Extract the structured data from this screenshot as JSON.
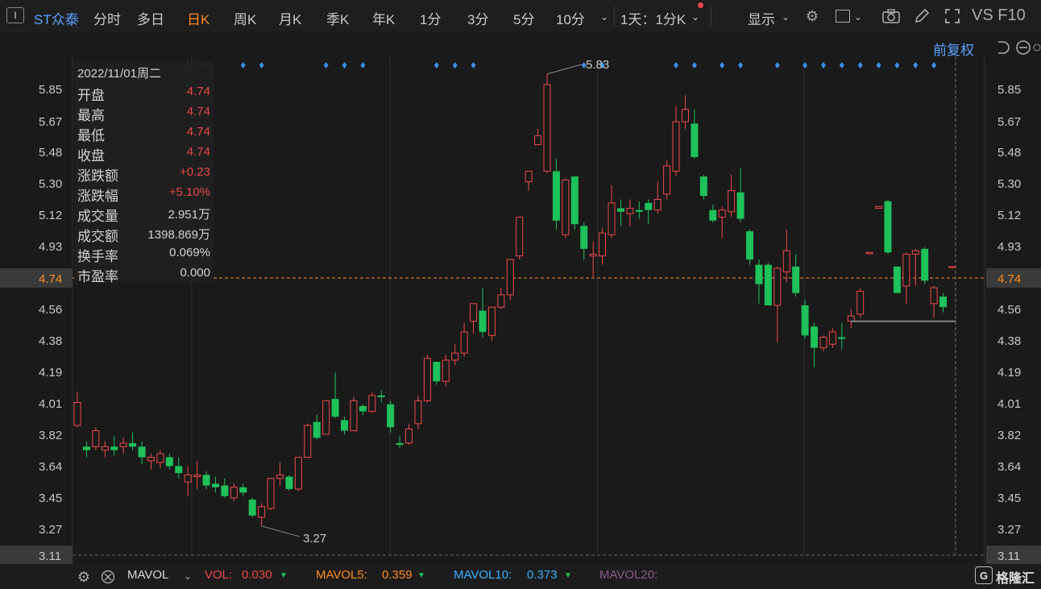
{
  "toolbar": {
    "symbol": "ST众泰",
    "tabs": [
      "分时",
      "多日",
      "日K",
      "周K",
      "月K",
      "季K",
      "年K",
      "1分",
      "3分",
      "5分",
      "10分"
    ],
    "active_tab": "日K",
    "period_select": "1天：1分K",
    "display": "显示",
    "right_text": "VS F10"
  },
  "adjust": "前复权",
  "colors": {
    "up": "#f04848",
    "down": "#1fc15a",
    "accent": "#ff8a1f",
    "blue": "#5aa0ff",
    "bg": "#1a1a1a"
  },
  "infobox": {
    "date": "2022/11/01周二",
    "rows": [
      {
        "label": "开盘",
        "value": "4.74",
        "color": "red"
      },
      {
        "label": "最高",
        "value": "4.74",
        "color": "red"
      },
      {
        "label": "最低",
        "value": "4.74",
        "color": "red"
      },
      {
        "label": "收盘",
        "value": "4.74",
        "color": "red"
      },
      {
        "label": "涨跌额",
        "value": "+0.23",
        "color": "red"
      },
      {
        "label": "涨跌幅",
        "value": "+5.10%",
        "color": "red"
      },
      {
        "label": "成交量",
        "value": "2.951万",
        "color": "white"
      },
      {
        "label": "成交额",
        "value": "1398.869万",
        "color": "white"
      },
      {
        "label": "换手率",
        "value": "0.069%",
        "color": "white"
      },
      {
        "label": "市盈率",
        "value": "0.000",
        "color": "white"
      }
    ]
  },
  "price_ticks": [
    "5.85",
    "5.67",
    "5.48",
    "5.30",
    "5.12",
    "4.93",
    "4.74",
    "4.56",
    "4.38",
    "4.19",
    "4.01",
    "3.82",
    "3.64",
    "3.45",
    "3.27",
    "3.11"
  ],
  "current_price": "4.74",
  "low_price": "3.11",
  "max_label": "5.83",
  "min_label": "3.27",
  "chart_data": {
    "type": "candlestick",
    "ylim": [
      3.11,
      5.93
    ],
    "candles": [
      [
        3.84,
        3.97,
        4.03,
        3.83
      ],
      [
        3.72,
        3.7,
        3.75,
        3.66
      ],
      [
        3.72,
        3.81,
        3.83,
        3.7
      ],
      [
        3.7,
        3.72,
        3.75,
        3.66
      ],
      [
        3.72,
        3.7,
        3.78,
        3.67
      ],
      [
        3.72,
        3.74,
        3.77,
        3.68
      ],
      [
        3.74,
        3.72,
        3.8,
        3.7
      ],
      [
        3.72,
        3.66,
        3.75,
        3.62
      ],
      [
        3.64,
        3.66,
        3.68,
        3.59
      ],
      [
        3.63,
        3.68,
        3.7,
        3.6
      ],
      [
        3.66,
        3.61,
        3.68,
        3.59
      ],
      [
        3.61,
        3.57,
        3.66,
        3.54
      ],
      [
        3.52,
        3.56,
        3.61,
        3.44
      ],
      [
        3.55,
        3.56,
        3.64,
        3.48
      ],
      [
        3.56,
        3.5,
        3.58,
        3.48
      ],
      [
        3.51,
        3.49,
        3.55,
        3.46
      ],
      [
        3.5,
        3.44,
        3.54,
        3.43
      ],
      [
        3.43,
        3.49,
        3.51,
        3.41
      ],
      [
        3.49,
        3.46,
        3.51,
        3.44
      ],
      [
        3.42,
        3.33,
        3.43,
        3.32
      ],
      [
        3.32,
        3.38,
        3.4,
        3.27
      ],
      [
        3.37,
        3.54,
        3.54,
        3.36
      ],
      [
        3.54,
        3.56,
        3.63,
        3.5
      ],
      [
        3.55,
        3.48,
        3.56,
        3.47
      ],
      [
        3.48,
        3.66,
        3.66,
        3.47
      ],
      [
        3.66,
        3.84,
        3.85,
        3.66
      ],
      [
        3.86,
        3.77,
        3.9,
        3.76
      ],
      [
        3.79,
        3.98,
        3.98,
        3.79
      ],
      [
        3.99,
        3.89,
        4.14,
        3.88
      ],
      [
        3.87,
        3.81,
        3.89,
        3.79
      ],
      [
        3.81,
        3.98,
        4.0,
        3.81
      ],
      [
        3.95,
        3.92,
        3.96,
        3.9
      ],
      [
        3.92,
        4.01,
        4.03,
        3.91
      ],
      [
        4.01,
        4.0,
        4.04,
        3.97
      ],
      [
        3.96,
        3.83,
        3.98,
        3.8
      ],
      [
        3.74,
        3.73,
        3.78,
        3.71
      ],
      [
        3.74,
        3.82,
        3.85,
        3.73
      ],
      [
        3.85,
        3.98,
        4.01,
        3.82
      ],
      [
        3.98,
        4.22,
        4.24,
        3.97
      ],
      [
        4.2,
        4.09,
        4.2,
        4.07
      ],
      [
        4.09,
        4.21,
        4.24,
        4.06
      ],
      [
        4.21,
        4.25,
        4.3,
        4.18
      ],
      [
        4.25,
        4.37,
        4.42,
        4.23
      ],
      [
        4.43,
        4.53,
        4.53,
        4.36
      ],
      [
        4.49,
        4.37,
        4.62,
        4.34
      ],
      [
        4.35,
        4.51,
        4.51,
        4.32
      ],
      [
        4.51,
        4.58,
        4.62,
        4.5
      ],
      [
        4.58,
        4.78,
        4.78,
        4.55
      ],
      [
        4.8,
        5.02,
        5.02,
        4.78
      ],
      [
        5.22,
        5.28,
        5.28,
        5.17
      ],
      [
        5.43,
        5.48,
        5.52,
        5.43
      ],
      [
        5.28,
        5.77,
        5.83,
        5.27
      ],
      [
        5.28,
        5.0,
        5.35,
        4.95
      ],
      [
        4.92,
        5.23,
        5.24,
        4.9
      ],
      [
        5.25,
        4.98,
        5.25,
        4.95
      ],
      [
        4.97,
        4.84,
        4.99,
        4.78
      ],
      [
        4.8,
        4.81,
        4.88,
        4.68
      ],
      [
        4.8,
        4.93,
        4.96,
        4.75
      ],
      [
        4.92,
        5.1,
        5.2,
        4.9
      ],
      [
        5.07,
        5.05,
        5.12,
        4.97
      ],
      [
        5.04,
        5.07,
        5.12,
        4.97
      ],
      [
        5.06,
        5.05,
        5.11,
        5.01
      ],
      [
        5.1,
        5.06,
        5.12,
        4.98
      ],
      [
        5.06,
        5.12,
        5.22,
        5.04
      ],
      [
        5.15,
        5.31,
        5.34,
        5.12
      ],
      [
        5.28,
        5.56,
        5.65,
        5.25
      ],
      [
        5.56,
        5.63,
        5.71,
        5.52
      ],
      [
        5.55,
        5.36,
        5.63,
        5.35
      ],
      [
        5.25,
        5.14,
        5.26,
        5.12
      ],
      [
        5.06,
        5.0,
        5.09,
        4.99
      ],
      [
        5.02,
        5.06,
        5.08,
        4.9
      ],
      [
        5.05,
        5.17,
        5.26,
        5.02
      ],
      [
        5.16,
        5.01,
        5.3,
        4.99
      ],
      [
        4.94,
        4.78,
        4.95,
        4.75
      ],
      [
        4.75,
        4.64,
        4.78,
        4.53
      ],
      [
        4.75,
        4.52,
        4.76,
        4.52
      ],
      [
        4.52,
        4.73,
        4.74,
        4.31
      ],
      [
        4.71,
        4.83,
        4.95,
        4.65
      ],
      [
        4.74,
        4.59,
        4.81,
        4.57
      ],
      [
        4.52,
        4.35,
        4.55,
        4.33
      ],
      [
        4.4,
        4.28,
        4.42,
        4.17
      ],
      [
        4.28,
        4.34,
        4.35,
        4.26
      ],
      [
        4.3,
        4.37,
        4.39,
        4.28
      ],
      [
        4.34,
        4.33,
        4.42,
        4.27
      ],
      [
        4.43,
        4.46,
        4.5,
        4.39
      ],
      [
        4.47,
        4.6,
        4.62,
        4.45
      ],
      [
        4.82,
        4.82,
        4.82,
        4.81
      ],
      [
        5.07,
        5.08,
        5.08,
        5.07
      ],
      [
        5.11,
        4.82,
        5.12,
        4.81
      ],
      [
        4.74,
        4.59,
        4.74,
        4.59
      ],
      [
        4.63,
        4.81,
        4.82,
        4.53
      ],
      [
        4.81,
        4.83,
        4.84,
        4.63
      ],
      [
        4.84,
        4.66,
        4.85,
        4.64
      ],
      [
        4.53,
        4.62,
        4.63,
        4.45
      ],
      [
        4.57,
        4.51,
        4.59,
        4.48
      ],
      [
        4.74,
        4.74,
        4.74,
        4.74
      ]
    ],
    "markers": [
      12,
      14,
      18,
      20,
      27,
      29,
      31,
      39,
      41,
      43,
      55,
      57,
      65,
      67,
      70,
      72,
      76,
      79,
      81,
      83,
      85,
      87,
      89,
      91,
      93
    ]
  },
  "bottom": {
    "indicator": "MAVOL",
    "vol_label": "VOL:",
    "vol_value": "0.030",
    "mavol5_label": "MAVOL5:",
    "mavol5_value": "0.359",
    "mavol10_label": "MAVOL10:",
    "mavol10_value": "0.373",
    "mavol20_label": "MAVOL20:",
    "brand": "格隆汇"
  }
}
